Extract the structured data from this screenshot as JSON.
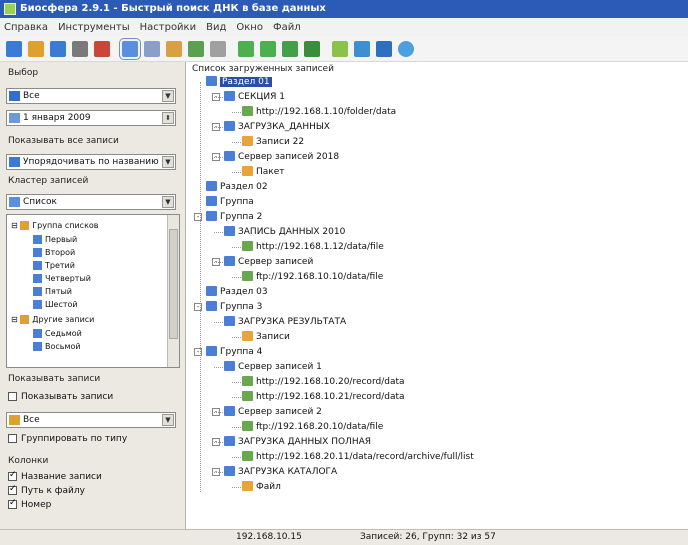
{
  "window": {
    "title": "Биосфера 2.9.1 - Быстрый поиск ДНК в базе данных"
  },
  "menu": [
    "Справка",
    "Инструменты",
    "Настройки",
    "Вид",
    "Окно",
    "Файл"
  ],
  "toolbar": {
    "icons": [
      "new-icon",
      "open-icon",
      "save-icon",
      "print-icon",
      "cut-icon",
      "select-icon",
      "copy-icon",
      "paste-icon",
      "undo-icon",
      "doc-icon",
      "tree-green-1-icon",
      "tree-green-2-icon",
      "tree-green-3-icon",
      "tree-green-4-icon",
      "filter-icon",
      "refresh-icon",
      "zoom-icon",
      "help-icon"
    ]
  },
  "left_panel": {
    "source_group_label": "Выбор",
    "source_value": "Все",
    "date_value": "1 января 2009",
    "filter_group_label": "Показывать все записи",
    "filter_value": "Упорядочивать по названию",
    "view_group_label": "Кластер записей",
    "view_value": "Список",
    "tree": [
      {
        "label": "Группа списков",
        "level": 0,
        "icon": "group"
      },
      {
        "label": "Первый",
        "level": 1,
        "icon": "item"
      },
      {
        "label": "Второй",
        "level": 1,
        "icon": "item"
      },
      {
        "label": "Третий",
        "level": 1,
        "icon": "item"
      },
      {
        "label": "Четвертый",
        "level": 1,
        "icon": "item"
      },
      {
        "label": "Пятый",
        "level": 1,
        "icon": "item"
      },
      {
        "label": "Шестой",
        "level": 1,
        "icon": "item"
      },
      {
        "label": "Другие записи",
        "level": 0,
        "icon": "group"
      },
      {
        "label": "Седьмой",
        "level": 1,
        "icon": "item"
      },
      {
        "label": "Восьмой",
        "level": 1,
        "icon": "item"
      }
    ],
    "sort_group_label": "Показывать записи",
    "sort_checkbox_label": "Показывать записи",
    "sort_value": "Все",
    "extra_checkbox_label": "Группировать по типу",
    "columns_group_label": "Колонки",
    "columns": [
      {
        "label": "Название записи",
        "checked": true
      },
      {
        "label": "Путь к файлу",
        "checked": true
      },
      {
        "label": "Номер",
        "checked": true
      }
    ]
  },
  "tree_panel": {
    "label": "Список загруженных записей",
    "nodes": [
      {
        "text": "Раздел 01",
        "depth": 0,
        "icon": "folder-blue",
        "selected": true
      },
      {
        "text": "СЕКЦИЯ 1",
        "depth": 1,
        "icon": "db",
        "expander": "-"
      },
      {
        "text": "http://192.168.1.10/folder/data",
        "depth": 2,
        "icon": "link"
      },
      {
        "text": "ЗАГРУЗКА_ДАННЫХ",
        "depth": 1,
        "icon": "db",
        "expander": "-"
      },
      {
        "text": "Записи 22",
        "depth": 2,
        "icon": "folder"
      },
      {
        "text": "Сервер записей 2018",
        "depth": 1,
        "icon": "db",
        "expander": "-"
      },
      {
        "text": "Пакет",
        "depth": 2,
        "icon": "folder"
      },
      {
        "text": "Раздел 02",
        "depth": 0,
        "icon": "folder-blue"
      },
      {
        "text": "Группа",
        "depth": 0,
        "icon": "folder-blue"
      },
      {
        "text": "Группа 2",
        "depth": 0,
        "icon": "folder-blue",
        "expander": "-"
      },
      {
        "text": "ЗАПИСЬ ДАННЫХ 2010",
        "depth": 1,
        "icon": "db"
      },
      {
        "text": "http://192.168.1.12/data/file",
        "depth": 2,
        "icon": "link"
      },
      {
        "text": "Сервер записей",
        "depth": 1,
        "icon": "db",
        "expander": "-"
      },
      {
        "text": "ftp://192.168.10.10/data/file",
        "depth": 2,
        "icon": "link"
      },
      {
        "text": "Раздел 03",
        "depth": 0,
        "icon": "folder-blue"
      },
      {
        "text": "Группа 3",
        "depth": 0,
        "icon": "folder-blue",
        "expander": "-"
      },
      {
        "text": "ЗАГРУЗКА РЕЗУЛЬТАТА",
        "depth": 1,
        "icon": "db"
      },
      {
        "text": "Записи",
        "depth": 2,
        "icon": "folder"
      },
      {
        "text": "Группа 4",
        "depth": 0,
        "icon": "folder-blue",
        "expander": "-"
      },
      {
        "text": "Сервер записей 1",
        "depth": 1,
        "icon": "db"
      },
      {
        "text": "http://192.168.10.20/record/data",
        "depth": 2,
        "icon": "link"
      },
      {
        "text": "http://192.168.10.21/record/data",
        "depth": 2,
        "icon": "link"
      },
      {
        "text": "Сервер записей 2",
        "depth": 1,
        "icon": "db",
        "expander": "-"
      },
      {
        "text": "ftp://192.168.20.10/data/file",
        "depth": 2,
        "icon": "link"
      },
      {
        "text": "ЗАГРУЗКА ДАННЫХ ПОЛНАЯ",
        "depth": 1,
        "icon": "db",
        "expander": "-"
      },
      {
        "text": "http://192.168.20.11/data/record/archive/full/list",
        "depth": 2,
        "icon": "link"
      },
      {
        "text": "ЗАГРУЗКА КАТАЛОГА",
        "depth": 1,
        "icon": "db",
        "expander": "-"
      },
      {
        "text": "Файл",
        "depth": 2,
        "icon": "folder"
      }
    ]
  },
  "status": {
    "left": "192.168.10.15",
    "right": "Записей: 26, Групп: 32 из 57"
  },
  "colors": {
    "titlebar": "#2b5bb7",
    "selection": "#2b4fa7",
    "folder": "#e8a33a",
    "db": "#4b7fd6",
    "link": "#6aa84f"
  }
}
